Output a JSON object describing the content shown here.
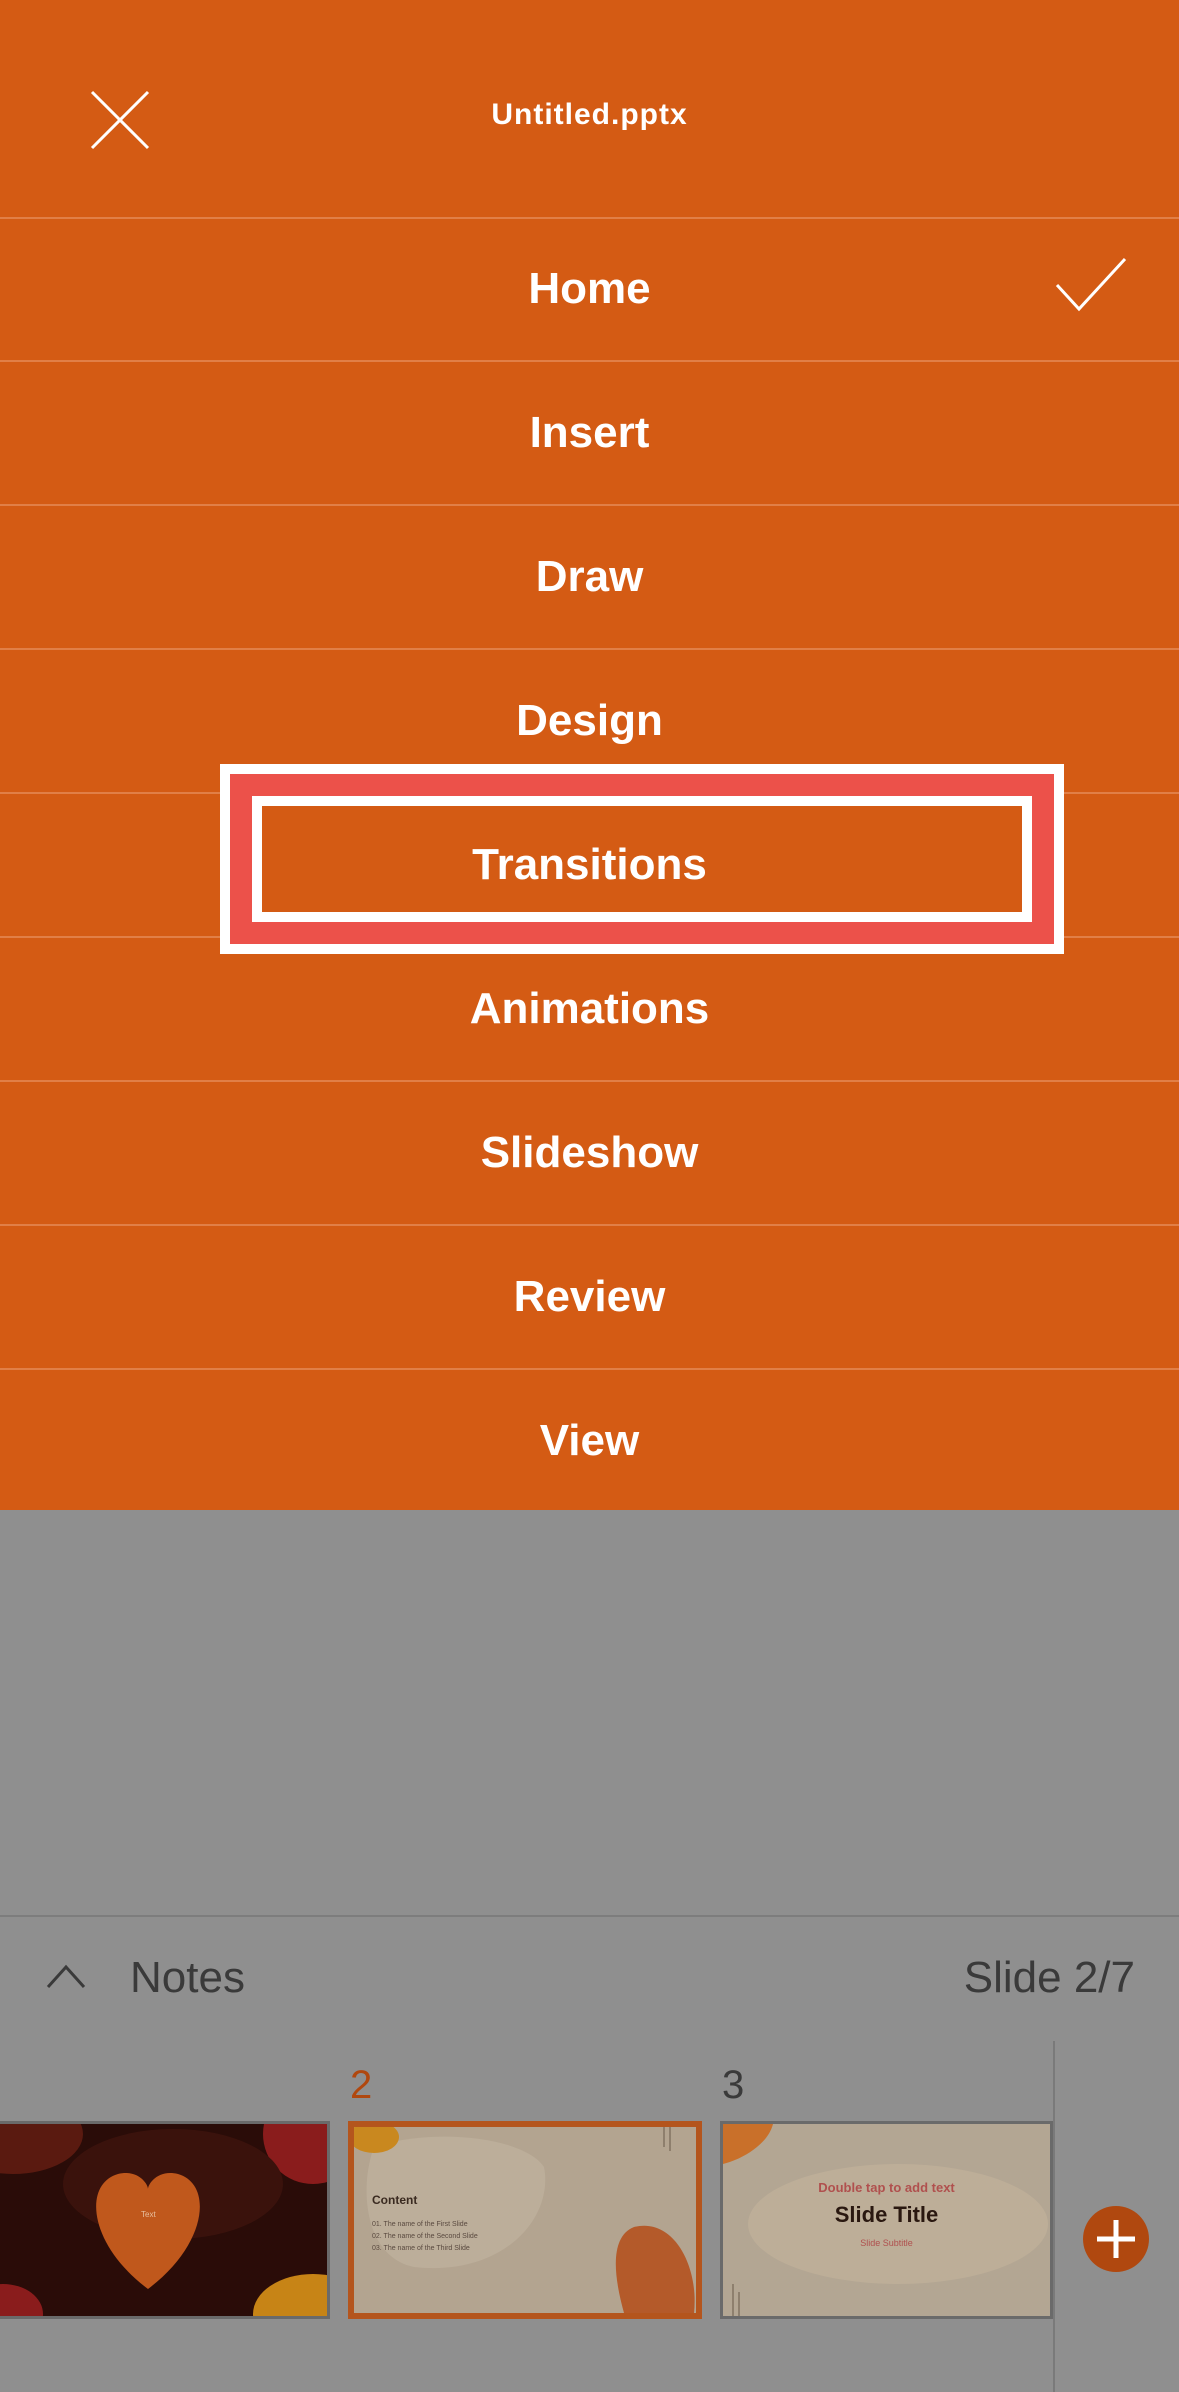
{
  "header": {
    "file_title": "Untitled.pptx"
  },
  "menu": {
    "items": [
      {
        "label": "Home",
        "selected": true
      },
      {
        "label": "Insert"
      },
      {
        "label": "Draw"
      },
      {
        "label": "Design"
      },
      {
        "label": "Transitions"
      },
      {
        "label": "Animations"
      },
      {
        "label": "Slideshow"
      },
      {
        "label": "Review"
      },
      {
        "label": "View"
      }
    ]
  },
  "notes_bar": {
    "label": "Notes",
    "slide_counter": "Slide 2/7"
  },
  "thumbnails": {
    "slides": [
      {
        "text": "Text"
      },
      {
        "number": "2",
        "title": "Content",
        "lines": [
          "01. The name of the First Slide",
          "02. The name of the Second Slide",
          "03. The name of the Third Slide"
        ]
      },
      {
        "number": "3",
        "top_text": "Double tap to add text",
        "title": "Slide Title",
        "subtitle": "Slide Subtitle"
      }
    ]
  },
  "colors": {
    "menu_bg": "#d45b14",
    "highlight": "#ec514a",
    "accent": "#b0480f",
    "backdrop": "#8f8f8f"
  },
  "icons": {
    "close": "close-icon",
    "check": "checkmark-icon",
    "chevron": "chevron-up-icon",
    "add": "plus-icon"
  }
}
